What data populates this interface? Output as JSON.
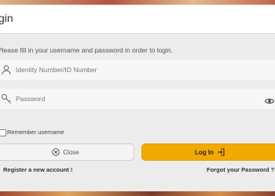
{
  "dialog": {
    "title": "gin",
    "instruction": "Please fill in your username and password in order to login."
  },
  "username": {
    "placeholder": "Identity Number/ID Number",
    "value": ""
  },
  "password": {
    "placeholder": "Password",
    "value": ""
  },
  "remember": {
    "label": "Remember username",
    "checked": false
  },
  "buttons": {
    "close_label": "Close",
    "login_label": "Log In"
  },
  "links": {
    "register": "Register a new account !",
    "forgot": "Forgot your Password ?"
  },
  "colors": {
    "accent": "#f2a900",
    "background": "#ececec"
  },
  "icons": {
    "username": "user-icon",
    "password": "key-icon",
    "toggle_visibility": "eye-icon",
    "close": "close-circle-icon",
    "login": "login-arrow-icon"
  }
}
